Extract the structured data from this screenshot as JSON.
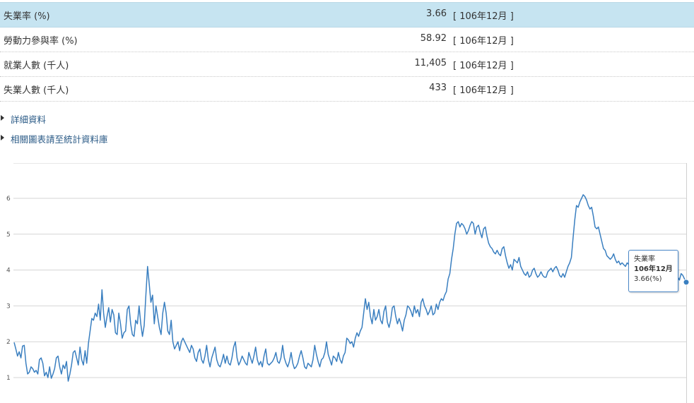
{
  "stats": [
    {
      "label": "失業率 (%)",
      "value": "3.66",
      "date": "[ 106年12月 ]"
    },
    {
      "label": "勞動力參與率 (%)",
      "value": "58.92",
      "date": "[ 106年12月 ]"
    },
    {
      "label": "就業人數 (千人)",
      "value": "11,405",
      "date": "[ 106年12月 ]"
    },
    {
      "label": "失業人數 (千人)",
      "value": "433",
      "date": "[ 106年12月 ]"
    }
  ],
  "links": [
    {
      "label": "詳細資料"
    },
    {
      "label": "相關圖表請至統計資料庫"
    }
  ],
  "tooltip": {
    "series": "失業率",
    "date": "106年12月",
    "value": "3.66(%)"
  },
  "colors": {
    "line": "#3a7fc0",
    "highlight": "#c6e4f1"
  },
  "chart_data": {
    "type": "line",
    "ylim": [
      0.9,
      6.9
    ],
    "yticks": [
      1,
      2,
      3,
      4,
      5,
      6
    ],
    "grid": true,
    "series": [
      {
        "name": "失業率",
        "values": [
          1.98,
          1.8,
          1.6,
          1.72,
          1.55,
          1.88,
          1.9,
          1.4,
          1.1,
          1.15,
          1.3,
          1.25,
          1.15,
          1.2,
          1.1,
          1.5,
          1.55,
          1.4,
          1.05,
          1.15,
          1.0,
          1.3,
          0.98,
          1.1,
          1.25,
          1.55,
          1.6,
          1.3,
          1.1,
          1.35,
          1.25,
          1.45,
          0.9,
          1.1,
          1.35,
          1.7,
          1.75,
          1.55,
          1.35,
          1.85,
          1.5,
          1.35,
          1.75,
          1.4,
          1.95,
          2.3,
          2.65,
          2.6,
          2.8,
          2.7,
          3.05,
          2.6,
          3.45,
          2.8,
          2.4,
          2.7,
          2.95,
          2.55,
          2.9,
          2.75,
          2.25,
          2.2,
          2.8,
          2.5,
          2.1,
          2.25,
          2.3,
          2.9,
          3.0,
          2.5,
          2.2,
          2.15,
          2.6,
          2.5,
          3.0,
          2.5,
          2.15,
          2.45,
          3.3,
          4.1,
          3.6,
          3.1,
          3.3,
          2.5,
          3.0,
          2.7,
          2.4,
          2.2,
          2.8,
          3.1,
          2.8,
          2.3,
          2.2,
          2.6,
          2.0,
          1.8,
          1.9,
          2.0,
          1.75,
          2.0,
          2.1,
          2.0,
          1.9,
          1.8,
          1.7,
          1.9,
          1.8,
          1.55,
          1.45,
          1.7,
          1.8,
          1.5,
          1.4,
          1.6,
          1.9,
          1.5,
          1.3,
          1.55,
          1.7,
          1.85,
          1.5,
          1.35,
          1.3,
          1.45,
          1.65,
          1.4,
          1.6,
          1.4,
          1.35,
          1.55,
          1.85,
          2.0,
          1.55,
          1.35,
          1.45,
          1.6,
          1.5,
          1.4,
          1.35,
          1.7,
          1.55,
          1.4,
          1.6,
          1.85,
          1.5,
          1.35,
          1.45,
          1.3,
          1.6,
          1.8,
          1.4,
          1.35,
          1.4,
          1.45,
          1.55,
          1.7,
          1.45,
          1.4,
          1.55,
          1.9,
          1.55,
          1.4,
          1.3,
          1.45,
          1.7,
          1.4,
          1.25,
          1.3,
          1.4,
          1.6,
          1.75,
          1.55,
          1.3,
          1.25,
          1.4,
          1.35,
          1.3,
          1.5,
          1.9,
          1.65,
          1.45,
          1.3,
          1.5,
          1.55,
          1.7,
          2.0,
          1.65,
          1.5,
          1.35,
          1.6,
          1.55,
          1.45,
          1.7,
          1.5,
          1.4,
          1.6,
          1.7,
          2.1,
          2.05,
          1.95,
          2.0,
          1.85,
          2.1,
          2.25,
          2.15,
          2.3,
          2.4,
          2.8,
          3.2,
          2.9,
          3.1,
          2.7,
          2.5,
          2.9,
          2.6,
          2.7,
          2.9,
          2.6,
          2.5,
          2.85,
          3.0,
          2.55,
          2.4,
          2.6,
          2.95,
          3.0,
          2.7,
          2.5,
          2.65,
          2.5,
          2.3,
          2.6,
          2.75,
          3.0,
          2.95,
          2.85,
          2.7,
          3.0,
          2.8,
          2.9,
          2.7,
          3.1,
          3.2,
          3.0,
          2.9,
          2.75,
          2.85,
          3.0,
          2.75,
          2.8,
          3.05,
          2.9,
          3.1,
          3.2,
          3.15,
          3.3,
          3.4,
          3.75,
          3.9,
          4.3,
          4.6,
          5.0,
          5.3,
          5.35,
          5.2,
          5.3,
          5.25,
          5.15,
          5.0,
          5.1,
          5.25,
          5.35,
          5.3,
          5.0,
          5.2,
          5.25,
          5.05,
          4.9,
          5.15,
          5.2,
          4.95,
          4.75,
          4.65,
          4.6,
          4.5,
          4.45,
          4.55,
          4.45,
          4.4,
          4.6,
          4.65,
          4.4,
          4.2,
          4.05,
          4.15,
          4.0,
          4.3,
          4.25,
          4.2,
          4.35,
          4.1,
          4.0,
          3.9,
          3.85,
          3.95,
          3.8,
          3.85,
          4.0,
          4.05,
          3.9,
          3.8,
          3.85,
          3.95,
          3.85,
          3.8,
          3.8,
          3.95,
          4.0,
          4.05,
          3.95,
          4.05,
          4.1,
          4.0,
          3.85,
          3.8,
          3.9,
          3.8,
          3.95,
          4.1,
          4.2,
          4.35,
          4.9,
          5.4,
          5.8,
          5.75,
          5.9,
          6.0,
          6.1,
          6.05,
          5.95,
          5.8,
          5.7,
          5.75,
          5.5,
          5.2,
          5.15,
          5.2,
          5.0,
          4.8,
          4.6,
          4.55,
          4.4,
          4.35,
          4.3,
          4.35,
          4.45,
          4.3,
          4.2,
          4.25,
          4.15,
          4.2,
          4.15,
          4.1,
          4.2,
          4.15,
          4.3,
          4.4,
          4.35,
          4.3,
          4.2,
          4.25,
          4.3,
          4.1,
          4.2,
          4.05,
          4.1,
          4.0,
          3.95,
          4.05,
          3.9,
          3.85,
          3.8,
          3.9,
          3.95,
          3.85,
          3.88,
          3.9,
          3.8,
          3.75,
          3.72,
          3.78,
          3.7,
          3.75,
          3.8,
          3.72,
          3.9,
          3.85,
          3.75,
          3.66
        ]
      }
    ]
  }
}
